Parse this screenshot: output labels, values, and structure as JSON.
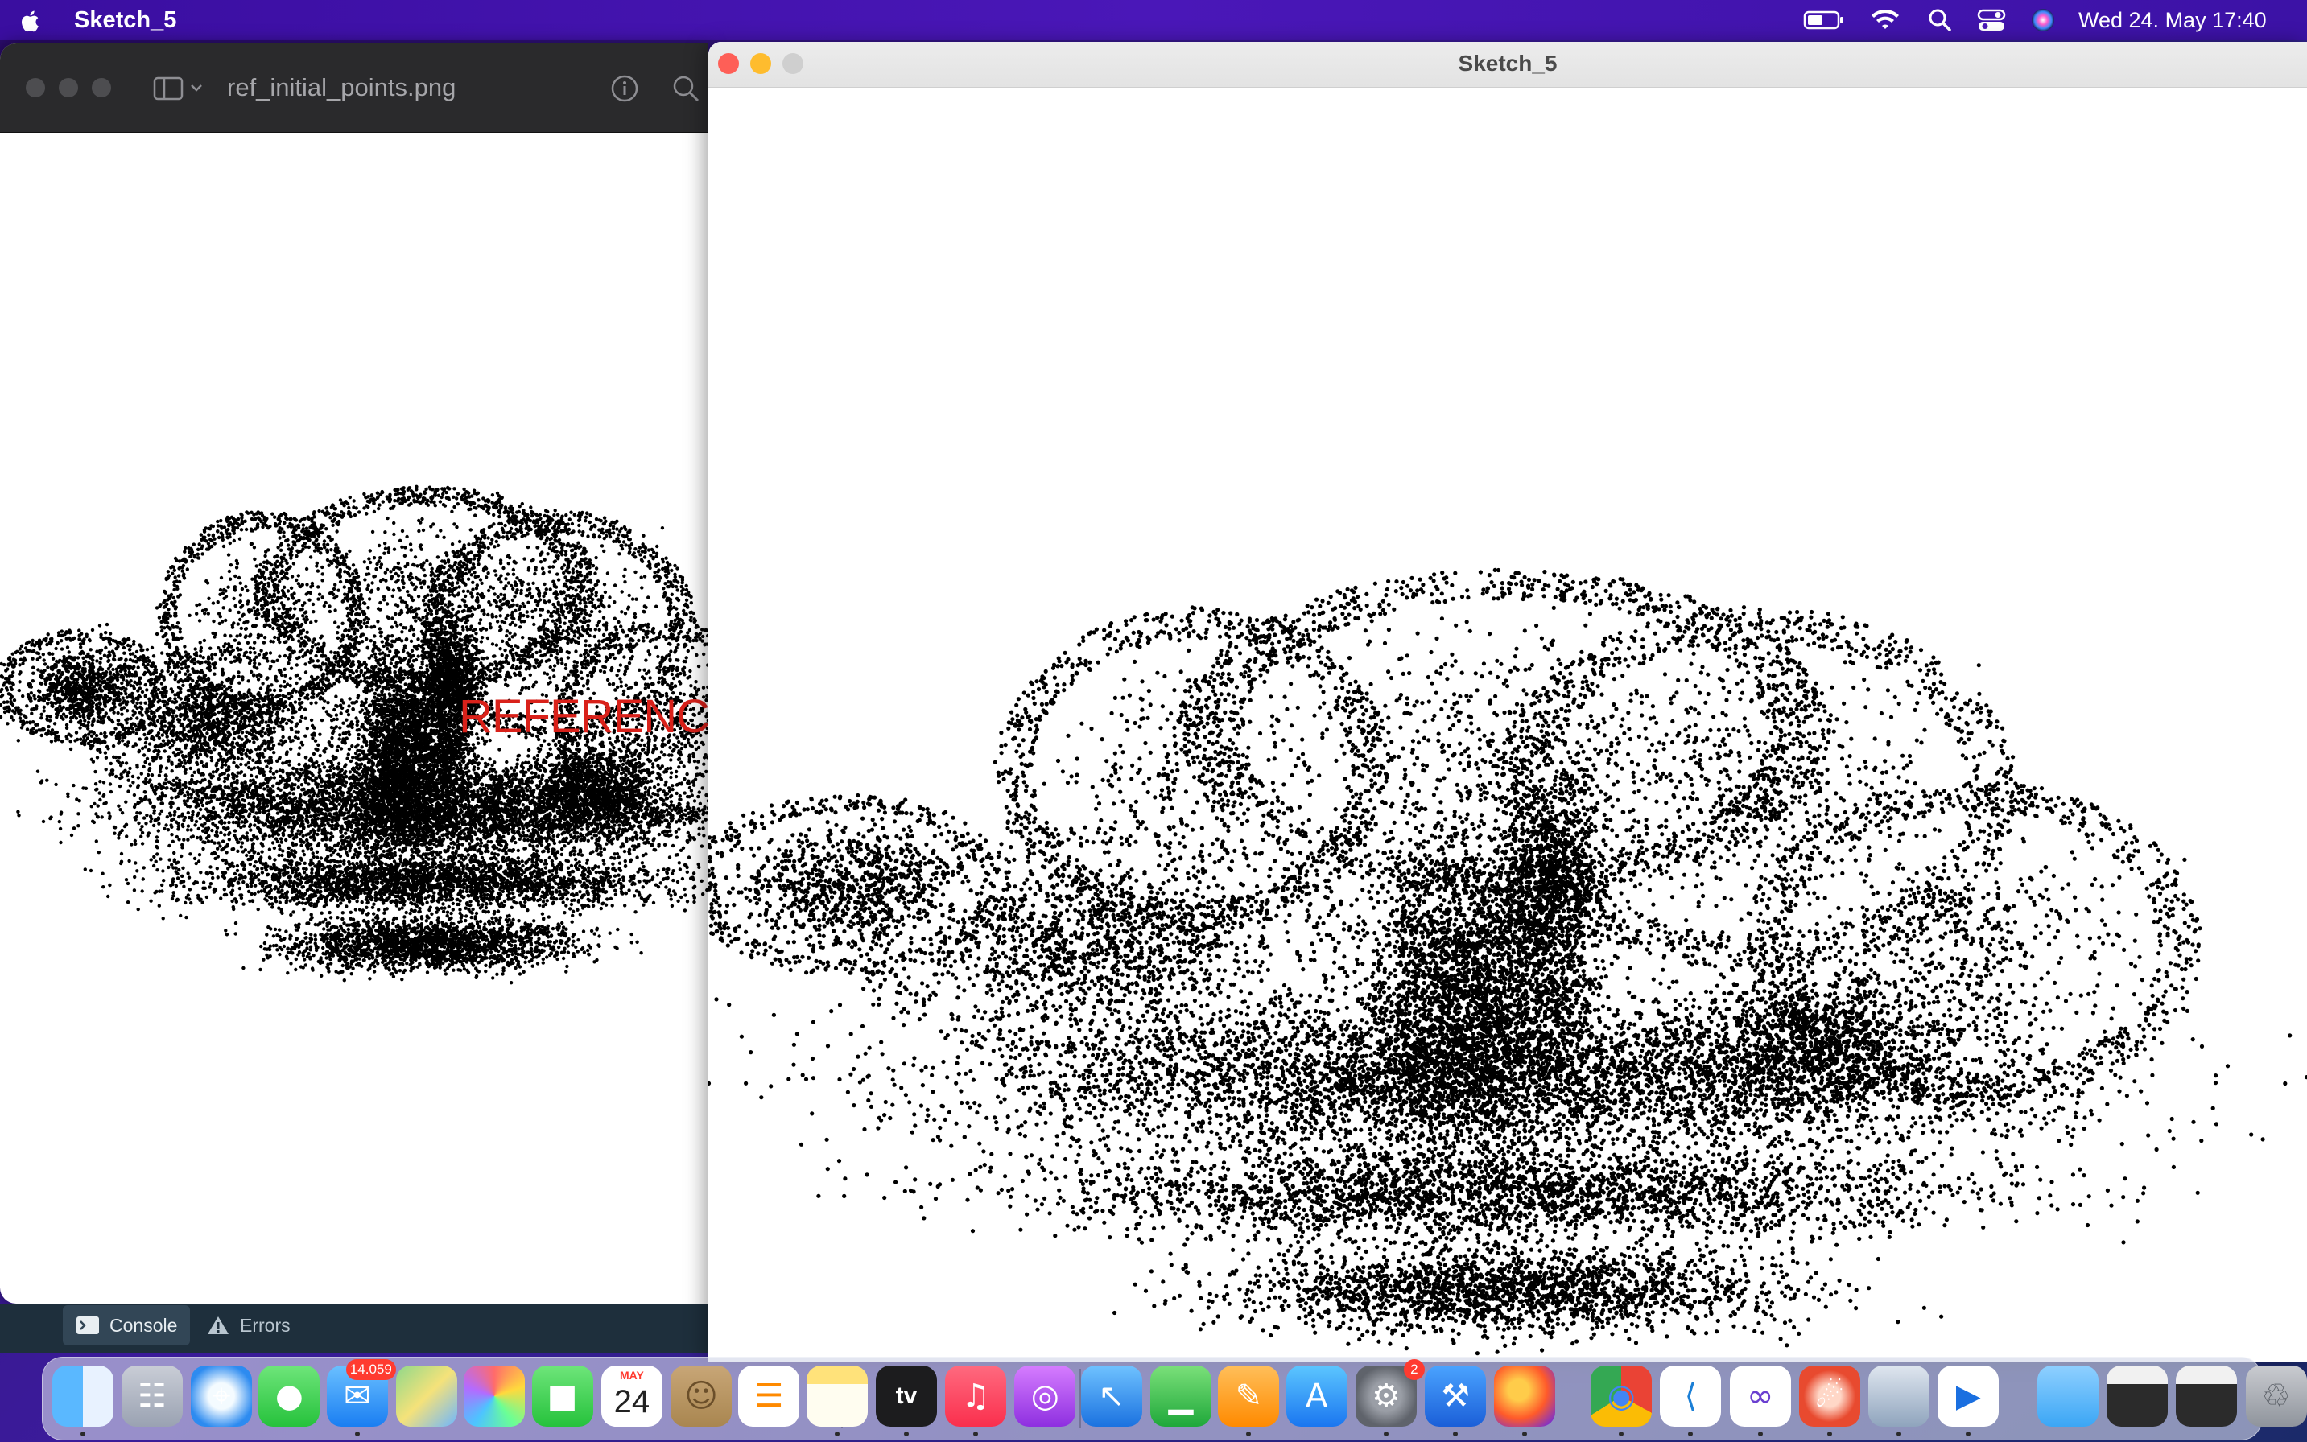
{
  "menubar": {
    "app_name": "Sketch_5",
    "clock": "Wed 24. May  17:40",
    "status_icons": [
      "battery-icon",
      "wifi-icon",
      "search-icon",
      "control-center-icon",
      "siri-icon"
    ]
  },
  "preview_window": {
    "filename": "ref_initial_points.png",
    "overlay_label": "REFERENCE",
    "toolbar_icons": [
      "sidebar-toggle-icon",
      "info-icon",
      "zoom-icon"
    ]
  },
  "console_panel": {
    "tabs": [
      {
        "label": "Console",
        "icon": "terminal-icon",
        "active": true
      },
      {
        "label": "Errors",
        "icon": "warning-icon",
        "active": false
      }
    ]
  },
  "sketch_window": {
    "title": "Sketch_5"
  },
  "colors": {
    "close": "#fe5f57",
    "minimize": "#febc2e",
    "maximize_inactive": "#cfcfcf",
    "reference_text": "#d9211a",
    "points": "#000000"
  },
  "dock": {
    "items": [
      {
        "name": "Finder",
        "icon": "finder-icon",
        "running": true
      },
      {
        "name": "Launchpad",
        "icon": "launchpad-icon",
        "running": false
      },
      {
        "name": "Safari",
        "icon": "safari-icon",
        "running": false
      },
      {
        "name": "Messages",
        "icon": "messages-icon",
        "running": false
      },
      {
        "name": "Mail",
        "icon": "mail-icon",
        "running": true,
        "badge": "14.059"
      },
      {
        "name": "Maps",
        "icon": "maps-icon",
        "running": false
      },
      {
        "name": "Photos",
        "icon": "photos-icon",
        "running": false
      },
      {
        "name": "FaceTime",
        "icon": "facetime-icon",
        "running": false
      },
      {
        "name": "Calendar",
        "icon": "calendar-icon",
        "running": false,
        "month": "MAY",
        "day": "24"
      },
      {
        "name": "Contacts",
        "icon": "contacts-icon",
        "running": false
      },
      {
        "name": "Reminders",
        "icon": "reminders-icon",
        "running": false
      },
      {
        "name": "Notes",
        "icon": "notes-icon",
        "running": true
      },
      {
        "name": "TV",
        "icon": "tv-icon",
        "running": true,
        "text": "tv"
      },
      {
        "name": "Music",
        "icon": "music-icon",
        "running": true
      },
      {
        "name": "Podcasts",
        "icon": "podcasts-icon",
        "running": false
      },
      {
        "name": "Keynote",
        "icon": "keynote-icon",
        "running": false
      },
      {
        "name": "Numbers",
        "icon": "numbers-icon",
        "running": false
      },
      {
        "name": "Pages",
        "icon": "pages-icon",
        "running": true
      },
      {
        "name": "App Store",
        "icon": "app-store-icon",
        "running": false
      },
      {
        "name": "System Settings",
        "icon": "settings-icon",
        "running": true,
        "badge": "2"
      },
      {
        "name": "Xcode",
        "icon": "xcode-icon",
        "running": true
      },
      {
        "name": "Firefox",
        "icon": "firefox-icon",
        "running": true
      },
      {
        "name": "Chrome",
        "icon": "chrome-icon",
        "running": true
      },
      {
        "name": "VS Code",
        "icon": "vscode-icon",
        "running": true
      },
      {
        "name": "Visual Studio",
        "icon": "visual-studio-icon",
        "running": true
      },
      {
        "name": "Instruments",
        "icon": "instruments-icon",
        "running": true
      },
      {
        "name": "Preview",
        "icon": "preview-icon",
        "running": true
      },
      {
        "name": "Processing",
        "icon": "processing-icon",
        "running": true
      },
      {
        "name": "Downloads",
        "icon": "folder-icon",
        "running": false
      },
      {
        "name": "Recent Window 1",
        "icon": "window-thumb-icon",
        "running": false
      },
      {
        "name": "Recent Window 2",
        "icon": "window-thumb-icon",
        "running": false
      },
      {
        "name": "Trash",
        "icon": "trash-icon",
        "running": false
      }
    ]
  }
}
